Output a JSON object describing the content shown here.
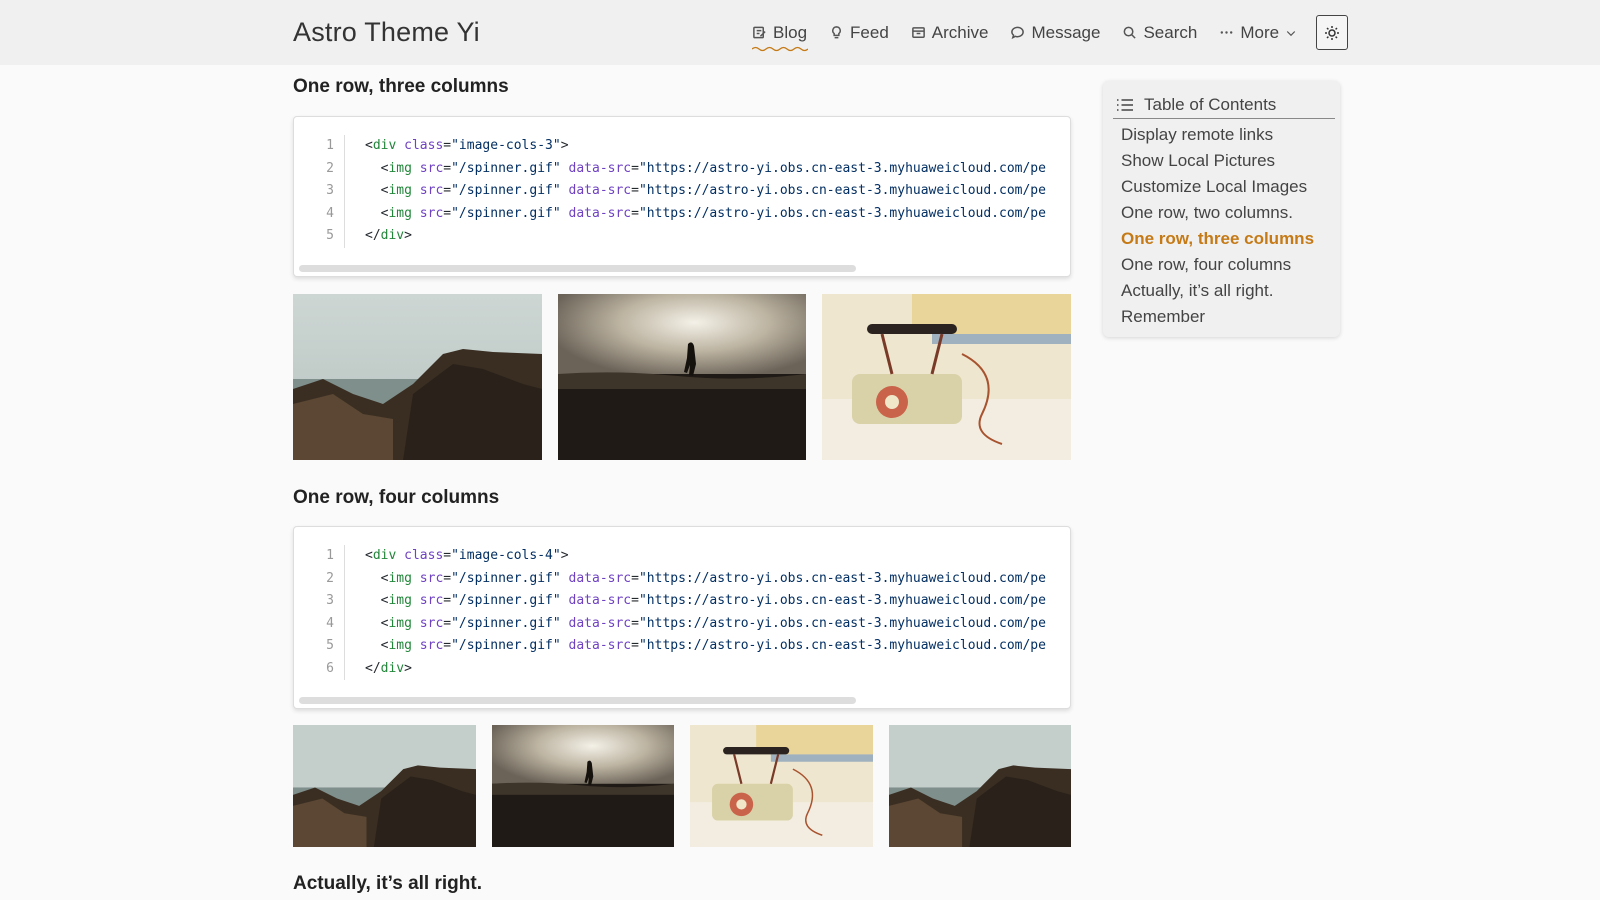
{
  "header": {
    "site_title": "Astro Theme Yi",
    "nav": [
      {
        "label": "Blog",
        "icon": "edit-icon",
        "active": true
      },
      {
        "label": "Feed",
        "icon": "bulb-icon"
      },
      {
        "label": "Archive",
        "icon": "archive-icon"
      },
      {
        "label": "Message",
        "icon": "message-icon"
      },
      {
        "label": "Search",
        "icon": "search-icon"
      },
      {
        "label": "More",
        "icon": "more-icon"
      }
    ],
    "active_underline_color": "#c57a16",
    "theme_toggle_icon": "sun-icon"
  },
  "sections": {
    "three_cols": {
      "heading": "One row, three columns",
      "code": [
        {
          "n": "1",
          "indent": "",
          "open_tag": "<div",
          "attrs": [
            {
              "name": "class",
              "value": "\"image-cols-3\""
            }
          ],
          "close": ">"
        },
        {
          "n": "2",
          "indent": "  ",
          "open_tag": "<img",
          "attrs": [
            {
              "name": "src",
              "value": "\"/spinner.gif\""
            },
            {
              "name": "data-src",
              "value": "\"https://astro-yi.obs.cn-east-3.myhuaweicloud.com/pe"
            }
          ],
          "close": ""
        },
        {
          "n": "3",
          "indent": "  ",
          "open_tag": "<img",
          "attrs": [
            {
              "name": "src",
              "value": "\"/spinner.gif\""
            },
            {
              "name": "data-src",
              "value": "\"https://astro-yi.obs.cn-east-3.myhuaweicloud.com/pe"
            }
          ],
          "close": ""
        },
        {
          "n": "4",
          "indent": "  ",
          "open_tag": "<img",
          "attrs": [
            {
              "name": "src",
              "value": "\"/spinner.gif\""
            },
            {
              "name": "data-src",
              "value": "\"https://astro-yi.obs.cn-east-3.myhuaweicloud.com/pe"
            }
          ],
          "close": ""
        },
        {
          "n": "5",
          "indent": "",
          "open_tag": "</div",
          "attrs": [],
          "close": ">"
        }
      ]
    },
    "four_cols": {
      "heading": "One row, four columns",
      "code": [
        {
          "n": "1",
          "indent": "",
          "open_tag": "<div",
          "attrs": [
            {
              "name": "class",
              "value": "\"image-cols-4\""
            }
          ],
          "close": ">"
        },
        {
          "n": "2",
          "indent": "  ",
          "open_tag": "<img",
          "attrs": [
            {
              "name": "src",
              "value": "\"/spinner.gif\""
            },
            {
              "name": "data-src",
              "value": "\"https://astro-yi.obs.cn-east-3.myhuaweicloud.com/pe"
            }
          ],
          "close": ""
        },
        {
          "n": "3",
          "indent": "  ",
          "open_tag": "<img",
          "attrs": [
            {
              "name": "src",
              "value": "\"/spinner.gif\""
            },
            {
              "name": "data-src",
              "value": "\"https://astro-yi.obs.cn-east-3.myhuaweicloud.com/pe"
            }
          ],
          "close": ""
        },
        {
          "n": "4",
          "indent": "  ",
          "open_tag": "<img",
          "attrs": [
            {
              "name": "src",
              "value": "\"/spinner.gif\""
            },
            {
              "name": "data-src",
              "value": "\"https://astro-yi.obs.cn-east-3.myhuaweicloud.com/pe"
            }
          ],
          "close": ""
        },
        {
          "n": "5",
          "indent": "  ",
          "open_tag": "<img",
          "attrs": [
            {
              "name": "src",
              "value": "\"/spinner.gif\""
            },
            {
              "name": "data-src",
              "value": "\"https://astro-yi.obs.cn-east-3.myhuaweicloud.com/pe"
            }
          ],
          "close": ""
        },
        {
          "n": "6",
          "indent": "",
          "open_tag": "</div",
          "attrs": [],
          "close": ">"
        }
      ]
    },
    "all_right": {
      "heading": "Actually, it’s all right."
    }
  },
  "images": {
    "three": [
      "coast-cliff-photo",
      "beach-silhouette-photo",
      "vintage-telephone-photo"
    ],
    "four": [
      "coast-cliff-photo",
      "beach-silhouette-photo",
      "vintage-telephone-photo",
      "coast-cliff-photo"
    ]
  },
  "toc": {
    "title": "Table of Contents",
    "items": [
      "Display remote links",
      "Show Local Pictures",
      "Customize Local Images",
      "One row, two columns.",
      "One row, three columns",
      "One row, four columns",
      "Actually, it’s all right.",
      "Remember"
    ],
    "active_index": 4,
    "active_color": "#c57a16"
  }
}
